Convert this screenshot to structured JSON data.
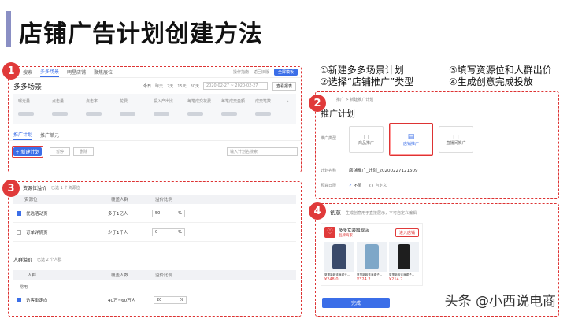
{
  "title": "店铺广告计划创建方法",
  "steps": {
    "s1": "①新建多多场景计划",
    "s2": "②选择“店铺推广”类型",
    "s3": "③填写资源位和人群出价",
    "s4": "④生成创意完成投放"
  },
  "badges": [
    "1",
    "2",
    "3",
    "4"
  ],
  "panel1": {
    "tabs": [
      "搜索",
      "多多场景",
      "明星店铺",
      "聚焦展位"
    ],
    "top_links": [
      "操作指南",
      "返回旧版"
    ],
    "top_button": "全屏模板",
    "section_title": "多多场景",
    "range_tabs": [
      "今日",
      "昨天",
      "7天",
      "15天",
      "30天"
    ],
    "date_range": "2020-02-27 ~ 2020-02-27",
    "report_button": "查看报表",
    "metrics": [
      "曝光量",
      "点击量",
      "点击率",
      "花费",
      "投入产出比",
      "每笔成交花费",
      "每笔成交金额",
      "成交笔数"
    ],
    "sub_tabs": [
      "推广计划",
      "推广单元"
    ],
    "new_plan_button": "+ 新建计划",
    "ghost_buttons": [
      "暂停",
      "删除"
    ],
    "search_placeholder": "输入计划名搜索"
  },
  "panel2": {
    "breadcrumb": "推广 > 新建推广计划",
    "heading": "推广计划",
    "type_label": "推广类型",
    "types": [
      "商品推广",
      "店铺推广",
      "直播间推广"
    ],
    "name_label": "计划名称",
    "name_value": "店铺推广_计划_20200227121509",
    "budget_label": "预算日限",
    "budget_options": [
      "不限",
      "自定义"
    ]
  },
  "panel3": {
    "res_title": "资源位溢价",
    "res_note": "已选 1 个资源位",
    "res_headers": [
      "资源位",
      "覆盖人群",
      "溢价比例"
    ],
    "res_rows": [
      {
        "name": "优选活动页",
        "reach": "多于1亿人",
        "value": "50",
        "unit": "%",
        "checked": true
      },
      {
        "name": "订单详情页",
        "reach": "少于1千人",
        "value": "0",
        "unit": "%",
        "checked": false
      }
    ],
    "crowd_title": "人群溢价",
    "crowd_note": "已选 2 个人群",
    "crowd_headers": [
      "人群",
      "覆盖人数",
      "溢价比例"
    ],
    "crowd_group": "常用",
    "crowd_rows": [
      {
        "name": "访客重定向",
        "reach": "40万~60万人",
        "value": "20",
        "unit": "%",
        "checked": true
      }
    ]
  },
  "panel4": {
    "heading": "创意",
    "hint": "生成创意用于直接展示，不可自定义编辑",
    "shop_name": "多多女装旗舰店",
    "shop_tag": "品牌商家",
    "enter_button": "进入店铺",
    "products": [
      {
        "name": "夏季新款连身裙子...",
        "price": "¥248.0",
        "color": "#3a4a6a"
      },
      {
        "name": "夏季新款连身裙子...",
        "price": "¥324.2",
        "color": "#7ea7c8"
      },
      {
        "name": "夏季新款连身裙子...",
        "price": "¥214.2",
        "color": "#1e1e1e"
      }
    ],
    "finish_button": "完成"
  },
  "watermark": "头条 @小西说电商",
  "colors": {
    "accent": "#3b6ee8",
    "highlight": "#e03a3a"
  }
}
